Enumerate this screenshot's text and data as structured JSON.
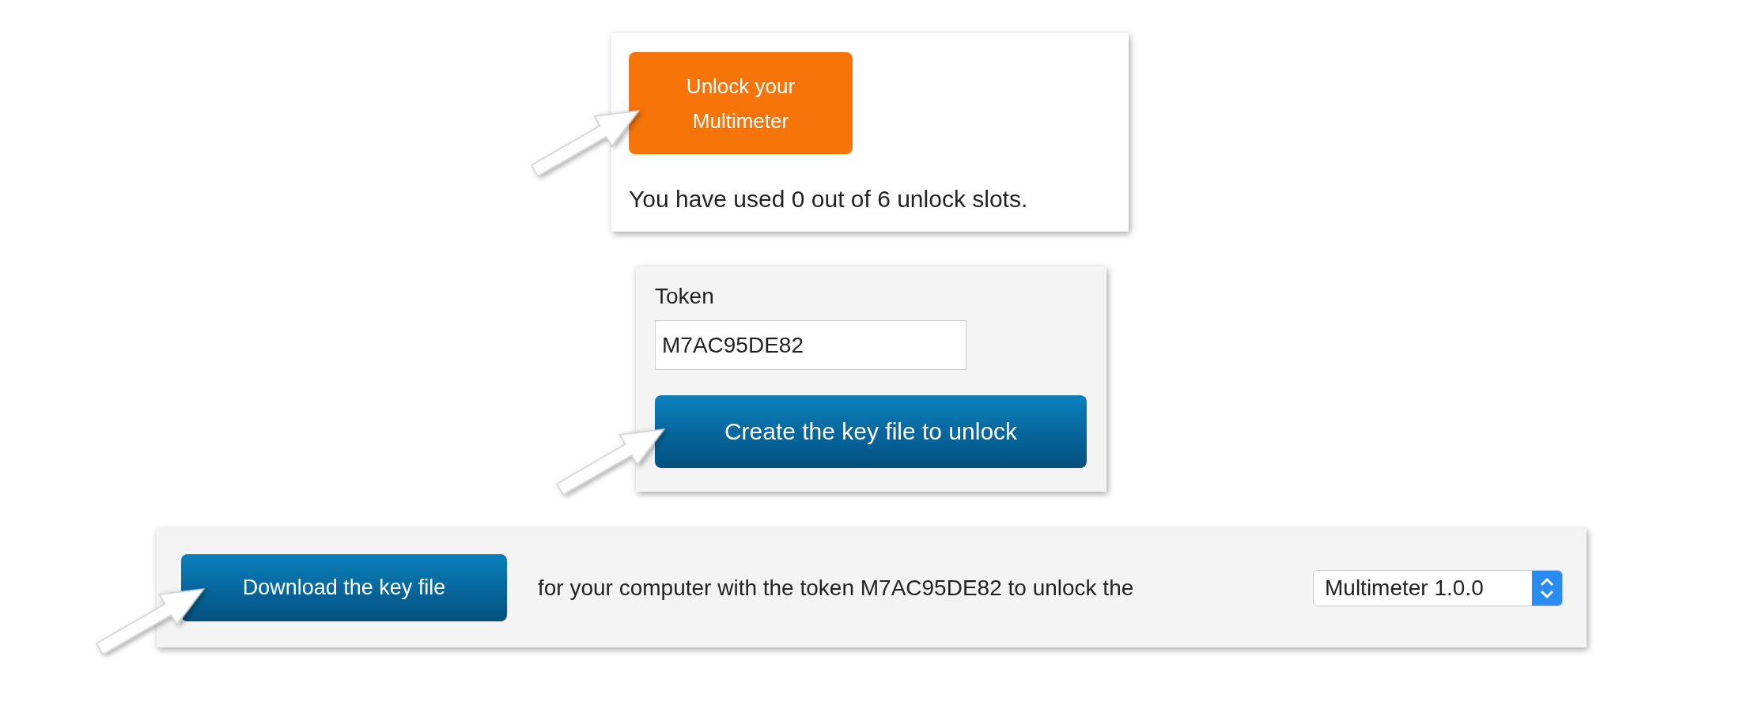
{
  "unlock_panel": {
    "button": "Unlock your Multimeter",
    "usage": "You have used 0 out of 6 unlock slots."
  },
  "token_panel": {
    "label": "Token",
    "token": {
      "value": "M7AC95DE82"
    },
    "button": "Create the key file to unlock"
  },
  "download_panel": {
    "button": "Download the key file",
    "description": "for your computer with the token M7AC95DE82 to unlock the",
    "product_select": {
      "value": "Multimeter 1.0.0"
    }
  }
}
